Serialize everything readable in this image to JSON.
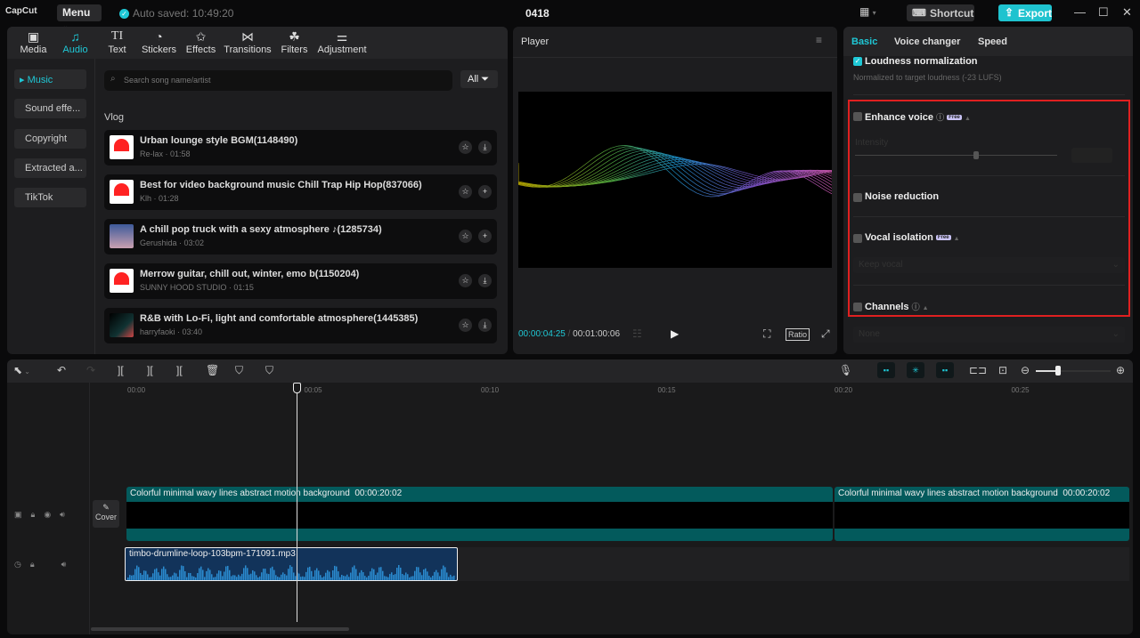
{
  "app": {
    "logo": "CapCut",
    "menu": "Menu",
    "saved": "Auto saved: 10:49:20",
    "project": "0418",
    "shortcut": "Shortcut",
    "export": "Export"
  },
  "tabs": [
    {
      "label": "Media",
      "icon": "media-icon"
    },
    {
      "label": "Audio",
      "icon": "audio-icon"
    },
    {
      "label": "Text",
      "icon": "text-icon"
    },
    {
      "label": "Stickers",
      "icon": "sticker-icon"
    },
    {
      "label": "Effects",
      "icon": "effects-icon"
    },
    {
      "label": "Transitions",
      "icon": "transitions-icon"
    },
    {
      "label": "Filters",
      "icon": "filters-icon"
    },
    {
      "label": "Adjustment",
      "icon": "adjustment-icon"
    }
  ],
  "categories": [
    "Music",
    "Sound effe...",
    "Copyright",
    "Extracted a...",
    "TikTok"
  ],
  "search": {
    "placeholder": "Search song name/artist",
    "filter": "All"
  },
  "section": "Vlog",
  "songs": [
    {
      "title": "Urban lounge style BGM(1148490)",
      "sub": "Re-lax · 01:58",
      "action": "download"
    },
    {
      "title": "Best for video background music Chill Trap Hip Hop(837066)",
      "sub": "Klh · 01:28",
      "action": "add"
    },
    {
      "title": "A chill pop truck with a sexy atmosphere ♪(1285734)",
      "sub": "Gerushida · 03:02",
      "action": "add"
    },
    {
      "title": "Merrow guitar, chill out, winter, emo b(1150204)",
      "sub": "SUNNY HOOD STUDIO · 01:15",
      "action": "download"
    },
    {
      "title": "R&B with Lo-Fi, light and comfortable atmosphere(1445385)",
      "sub": "harryfaoki · 03:40",
      "action": "download"
    }
  ],
  "player": {
    "title": "Player",
    "current": "00:00:04:25",
    "total": "00:01:00:06",
    "ratio": "Ratio"
  },
  "right": {
    "tabs": [
      "Basic",
      "Voice changer",
      "Speed"
    ],
    "loudness": "Loudness normalization",
    "loudness_desc": "Normalized to target loudness (-23 LUFS)",
    "enhance": "Enhance voice",
    "intensity": "Intensity",
    "intensity_value": 0.6,
    "noise": "Noise reduction",
    "vocal": "Vocal isolation",
    "keep_vocal": "Keep vocal",
    "channels": "Channels",
    "none": "None",
    "free": "Free"
  },
  "timeline": {
    "ticks": [
      "00:00",
      "00:05",
      "00:10",
      "00:15",
      "00:20",
      "00:25"
    ],
    "cover": "Cover",
    "zoom_level": 0.3,
    "video_clip": {
      "name": "Colorful minimal wavy lines abstract motion background",
      "duration": "00:00:20:02"
    },
    "audio_clip": {
      "name": "timbo-drumline-loop-103bpm-171091.mp3"
    }
  },
  "colors": {
    "accent": "#1fc8d6",
    "highlight": "#e02020"
  }
}
